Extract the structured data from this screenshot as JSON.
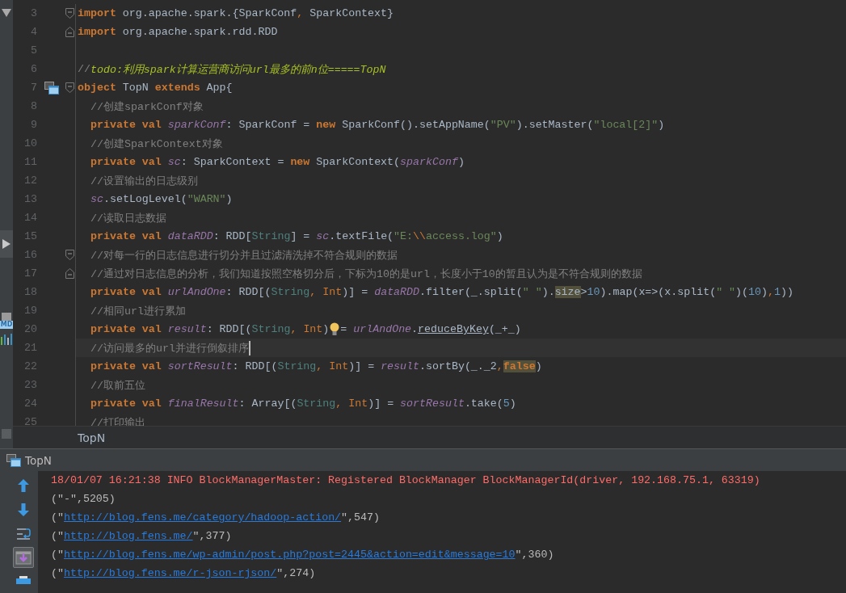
{
  "side_strip": {
    "badge": "MD"
  },
  "editor": {
    "lines": [
      {
        "n": "3",
        "fold_start": true,
        "tokens": [
          {
            "kind": "kw",
            "t": "import "
          },
          {
            "kind": "plain",
            "t": "org.apache.spark.{SparkConf"
          },
          {
            "kind": "sep",
            "t": ","
          },
          {
            "kind": "plain",
            "t": " SparkContext}"
          }
        ]
      },
      {
        "n": "4",
        "fold_end": true,
        "tokens": [
          {
            "kind": "kw",
            "t": "import "
          },
          {
            "kind": "plain",
            "t": "org.apache.spark.rdd.RDD"
          }
        ]
      },
      {
        "n": "5"
      },
      {
        "n": "6",
        "tokens": [
          {
            "kind": "comment",
            "t": "//"
          },
          {
            "kind": "todo",
            "t": "todo:利用spark计算运营商访问url最多的前n位=====TopN"
          }
        ]
      },
      {
        "n": "7",
        "fold_start": true,
        "run_marker": true,
        "tokens": [
          {
            "kind": "kw",
            "t": "object "
          },
          {
            "kind": "plain",
            "t": "TopN "
          },
          {
            "kind": "kw",
            "t": "extends "
          },
          {
            "kind": "plain",
            "t": "App{"
          }
        ],
        "children": [
          {
            "n": "8",
            "tokens": [
              {
                "kind": "comment",
                "t": "//创建sparkConf对象"
              }
            ]
          },
          {
            "n": "9",
            "tokens": [
              {
                "kind": "kw",
                "t": "private val "
              },
              {
                "kind": "field",
                "t": "sparkConf"
              },
              {
                "kind": "plain",
                "t": ": SparkConf = "
              },
              {
                "kind": "kw",
                "t": "new "
              },
              {
                "kind": "plain",
                "t": "SparkConf().setAppName("
              },
              {
                "kind": "str",
                "t": "\"PV\""
              },
              {
                "kind": "plain",
                "t": ").setMaster("
              },
              {
                "kind": "str",
                "t": "\"local[2]\""
              },
              {
                "kind": "plain",
                "t": ")"
              }
            ]
          },
          {
            "n": "10",
            "tokens": [
              {
                "kind": "comment",
                "t": "//创建SparkContext对象"
              }
            ]
          },
          {
            "n": "11",
            "tokens": [
              {
                "kind": "kw",
                "t": "private val "
              },
              {
                "kind": "field",
                "t": "sc"
              },
              {
                "kind": "plain",
                "t": ": SparkContext = "
              },
              {
                "kind": "kw",
                "t": "new "
              },
              {
                "kind": "plain",
                "t": "SparkContext("
              },
              {
                "kind": "field",
                "t": "sparkConf"
              },
              {
                "kind": "plain",
                "t": ")"
              }
            ]
          },
          {
            "n": "12",
            "tokens": [
              {
                "kind": "comment",
                "t": "//设置输出的日志级别"
              }
            ]
          },
          {
            "n": "13",
            "tokens": [
              {
                "kind": "field",
                "t": "sc"
              },
              {
                "kind": "plain",
                "t": ".setLogLevel("
              },
              {
                "kind": "str",
                "t": "\"WARN\""
              },
              {
                "kind": "plain",
                "t": ")"
              }
            ]
          },
          {
            "n": "14",
            "tokens": [
              {
                "kind": "comment",
                "t": "//读取日志数据"
              }
            ]
          },
          {
            "n": "15",
            "tokens": [
              {
                "kind": "kw",
                "t": "private val "
              },
              {
                "kind": "field",
                "t": "dataRDD"
              },
              {
                "kind": "plain",
                "t": ": RDD["
              },
              {
                "kind": "type",
                "t": "String"
              },
              {
                "kind": "plain",
                "t": "] = "
              },
              {
                "kind": "field",
                "t": "sc"
              },
              {
                "kind": "plain",
                "t": ".textFile("
              },
              {
                "kind": "str",
                "t": "\"E:"
              },
              {
                "kind": "sep",
                "t": "\\\\"
              },
              {
                "kind": "str",
                "t": "access.log\""
              },
              {
                "kind": "plain",
                "t": ")"
              }
            ]
          },
          {
            "n": "16",
            "fold_start": true,
            "tokens": [
              {
                "kind": "comment",
                "t": "//对每一行的日志信息进行切分并且过滤清洗掉不符合规则的数据"
              }
            ]
          },
          {
            "n": "17",
            "fold_end": true,
            "tokens": [
              {
                "kind": "comment",
                "t": "//通过对日志信息的分析，我们知道按照空格切分后，下标为10的是url，长度小于10的暂且认为是不符合规则的数据"
              }
            ]
          },
          {
            "n": "18",
            "tokens": [
              {
                "kind": "kw",
                "t": "private val "
              },
              {
                "kind": "field",
                "t": "urlAndOne"
              },
              {
                "kind": "plain",
                "t": ": RDD[("
              },
              {
                "kind": "type",
                "t": "String"
              },
              {
                "kind": "sep",
                "t": ", "
              },
              {
                "kind": "int",
                "t": "Int"
              },
              {
                "kind": "plain",
                "t": ")] = "
              },
              {
                "kind": "field",
                "t": "dataRDD"
              },
              {
                "kind": "plain",
                "t": ".filter(_.split("
              },
              {
                "kind": "str",
                "t": "\" \""
              },
              {
                "kind": "plain",
                "t": ")."
              },
              {
                "kind": "plain",
                "t": "size",
                "highlighted": true
              },
              {
                "kind": "plain",
                "t": ">"
              },
              {
                "kind": "num",
                "t": "10"
              },
              {
                "kind": "plain",
                "t": ").map(x=>(x.split("
              },
              {
                "kind": "str",
                "t": "\" \""
              },
              {
                "kind": "plain",
                "t": ")("
              },
              {
                "kind": "num",
                "t": "10"
              },
              {
                "kind": "plain",
                "t": ")"
              },
              {
                "kind": "sep",
                "t": ","
              },
              {
                "kind": "num",
                "t": "1"
              },
              {
                "kind": "plain",
                "t": "))"
              }
            ]
          },
          {
            "n": "19",
            "tokens": [
              {
                "kind": "comment",
                "t": "//相同url进行累加"
              }
            ]
          },
          {
            "n": "20",
            "tokens": [
              {
                "kind": "kw",
                "t": "private val "
              },
              {
                "kind": "field",
                "t": "result"
              },
              {
                "kind": "plain",
                "t": ": RDD[("
              },
              {
                "kind": "type",
                "t": "String"
              },
              {
                "kind": "sep",
                "t": ", "
              },
              {
                "kind": "int",
                "t": "Int"
              },
              {
                "kind": "plain",
                "t": ")"
              },
              {
                "kind": "bulb"
              },
              {
                "kind": "plain",
                "t": "= "
              },
              {
                "kind": "field",
                "t": "urlAndOne"
              },
              {
                "kind": "plain",
                "t": "."
              },
              {
                "kind": "plain",
                "t": "reduceByKey",
                "underlined": true
              },
              {
                "kind": "plain",
                "t": "(_+_)"
              }
            ]
          },
          {
            "n": "21",
            "current": true,
            "tokens": [
              {
                "kind": "comment",
                "t": "//访问最多的url并进行倒叙排序"
              }
            ]
          },
          {
            "n": "22",
            "tokens": [
              {
                "kind": "kw",
                "t": "private val "
              },
              {
                "kind": "field",
                "t": "sortResult"
              },
              {
                "kind": "plain",
                "t": ": RDD[("
              },
              {
                "kind": "type",
                "t": "String"
              },
              {
                "kind": "sep",
                "t": ", "
              },
              {
                "kind": "int",
                "t": "Int"
              },
              {
                "kind": "plain",
                "t": ")] = "
              },
              {
                "kind": "field",
                "t": "result"
              },
              {
                "kind": "plain",
                "t": ".sortBy(_._2"
              },
              {
                "kind": "sep",
                "t": ","
              },
              {
                "kind": "kw",
                "t": "false",
                "highlighted": true
              },
              {
                "kind": "plain",
                "t": ")"
              }
            ]
          },
          {
            "n": "23",
            "tokens": [
              {
                "kind": "comment",
                "t": "//取前五位"
              }
            ]
          },
          {
            "n": "24",
            "tokens": [
              {
                "kind": "kw",
                "t": "private val "
              },
              {
                "kind": "field",
                "t": "finalResult"
              },
              {
                "kind": "plain",
                "t": ": Array[("
              },
              {
                "kind": "type",
                "t": "String"
              },
              {
                "kind": "sep",
                "t": ", "
              },
              {
                "kind": "int",
                "t": "Int"
              },
              {
                "kind": "plain",
                "t": ")] = "
              },
              {
                "kind": "field",
                "t": "sortResult"
              },
              {
                "kind": "plain",
                "t": ".take("
              },
              {
                "kind": "num",
                "t": "5"
              },
              {
                "kind": "plain",
                "t": ")"
              }
            ]
          },
          {
            "n": "25",
            "tokens": [
              {
                "kind": "comment",
                "t": "//打印输出"
              }
            ]
          }
        ]
      }
    ],
    "breadcrumb": "TopN"
  },
  "console": {
    "tab": "TopN",
    "toolbar": [
      {
        "kind": "up",
        "on": false
      },
      {
        "kind": "down",
        "on": false
      },
      {
        "kind": "wrap",
        "on": false
      },
      {
        "kind": "scroll_end",
        "on": true
      },
      {
        "kind": "print",
        "on": false
      }
    ],
    "lines": [
      [
        {
          "kind": "error",
          "t": "18/01/07 16:21:38 INFO BlockManagerMaster: Registered BlockManager BlockManagerId(driver, 192.168.75.1, 63319)"
        }
      ],
      [
        {
          "kind": "plain",
          "t": "(\"-\",5205)"
        }
      ],
      [
        {
          "kind": "plain",
          "t": "(\""
        },
        {
          "kind": "link",
          "t": "http://blog.fens.me/category/hadoop-action/"
        },
        {
          "kind": "plain",
          "t": "\",547)"
        }
      ],
      [
        {
          "kind": "plain",
          "t": "(\""
        },
        {
          "kind": "link",
          "t": "http://blog.fens.me/"
        },
        {
          "kind": "plain",
          "t": "\",377)"
        }
      ],
      [
        {
          "kind": "plain",
          "t": "(\""
        },
        {
          "kind": "link",
          "t": "http://blog.fens.me/wp-admin/post.php?post=2445&action=edit&message=10"
        },
        {
          "kind": "plain",
          "t": "\",360)"
        }
      ],
      [
        {
          "kind": "plain",
          "t": "(\""
        },
        {
          "kind": "link",
          "t": "http://blog.fens.me/r-json-rjson/"
        },
        {
          "kind": "plain",
          "t": "\",274)"
        }
      ]
    ]
  }
}
